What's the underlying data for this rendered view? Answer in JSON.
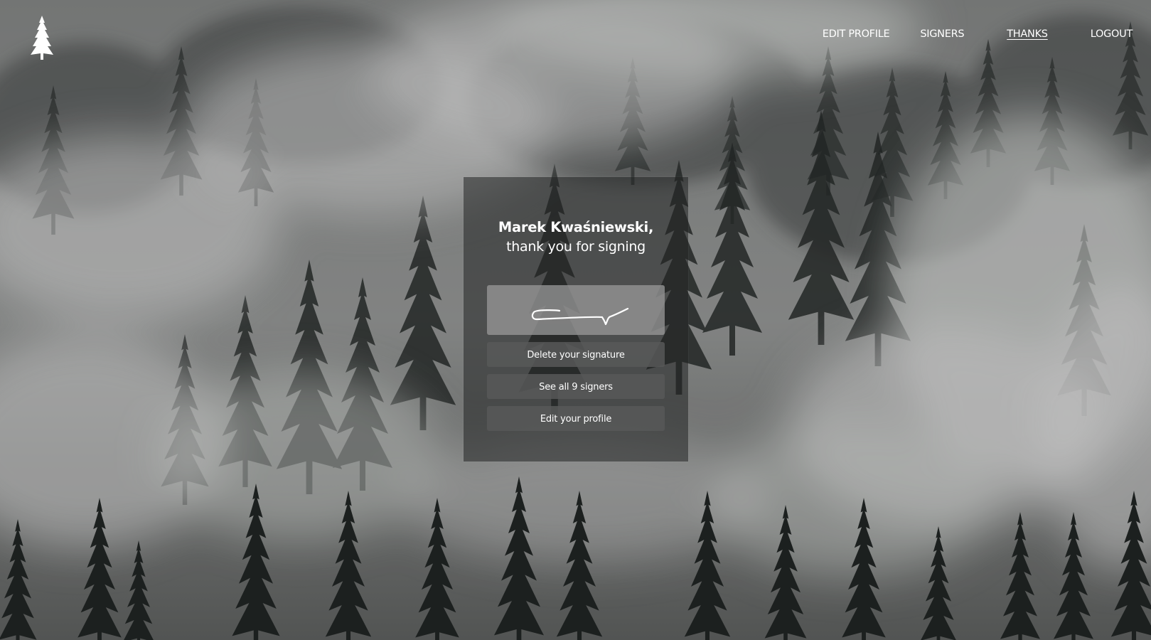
{
  "nav": {
    "edit_profile": "EDIT PROFILE",
    "signers": "SIGNERS",
    "thanks": "THANKS",
    "logout": "LOGOUT",
    "active": "thanks"
  },
  "logo": {
    "icon": "pine-tree-icon"
  },
  "card": {
    "name": "Marek Kwaśniewski,",
    "message": "thank you for signing",
    "delete_label": "Delete your signature",
    "signers_label": "See all 9 signers",
    "edit_label": "Edit your profile"
  },
  "colors": {
    "text": "#ffffff",
    "card_bg": "#232424",
    "button_bg": "#585858",
    "signature_bg": "#969696"
  }
}
